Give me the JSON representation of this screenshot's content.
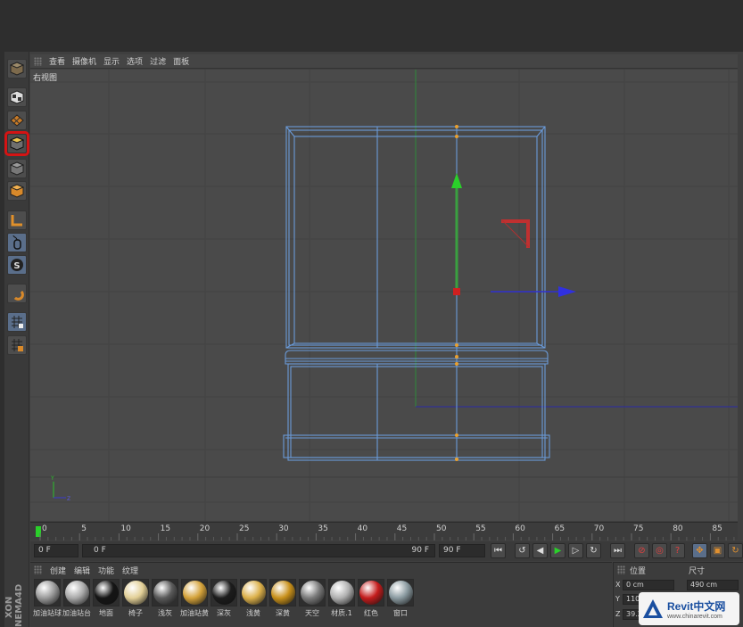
{
  "menu": {
    "items": [
      "查看",
      "摄像机",
      "显示",
      "选项",
      "过滤",
      "面板"
    ]
  },
  "viewport": {
    "label": "右视图"
  },
  "toolbar": {
    "tools": [
      "cube-view-icon",
      "checker-cube-icon",
      "texture-grid-icon",
      "polygon-object-icon",
      "cube-grey-icon",
      "cube-orange-icon",
      "axis-icon",
      "mouse-icon",
      "snap-s-icon",
      "magnet-icon",
      "grid-lock-icon",
      "grid-object-icon"
    ],
    "selected_tool": "polygon-object-icon"
  },
  "brand": "XON NEMA4D",
  "timeline": {
    "ticks": [
      "0",
      "5",
      "10",
      "15",
      "20",
      "25",
      "30",
      "35",
      "40",
      "45",
      "50",
      "55",
      "60",
      "65",
      "70",
      "75",
      "80",
      "85"
    ]
  },
  "playback": {
    "current_frame": "0 F",
    "range_start": "0 F",
    "range_end": "90 F",
    "max_frame": "90 F"
  },
  "materials": {
    "menu": [
      "创建",
      "编辑",
      "功能",
      "纹理"
    ],
    "items": [
      {
        "name": "加油站球",
        "color": "#9a9a9a"
      },
      {
        "name": "加油站台",
        "color": "#a8a8a8"
      },
      {
        "name": "地面",
        "color": "#151515"
      },
      {
        "name": "椅子",
        "color": "#e2cf96"
      },
      {
        "name": "浅灰",
        "color": "#5a5a5a"
      },
      {
        "name": "加油站黄",
        "color": "#d4a23a"
      },
      {
        "name": "深灰",
        "color": "#1c1c1c"
      },
      {
        "name": "浅黄",
        "color": "#dcb04a"
      },
      {
        "name": "深黄",
        "color": "#c8901a"
      },
      {
        "name": "天空",
        "color": "#7a7a7a"
      },
      {
        "name": "材质.1",
        "color": "#b0b0b0"
      },
      {
        "name": "红色",
        "color": "#c41c1c"
      },
      {
        "name": "窗口",
        "color": "#8a9aa0"
      }
    ]
  },
  "attributes": {
    "position_header": "位置",
    "size_header": "尺寸",
    "x_label": "X",
    "y_label": "Y",
    "z_label": "Z",
    "x_pos": "0 cm",
    "y_pos": "110",
    "z_pos": "39.2",
    "x_size": "490 cm"
  },
  "watermark": {
    "title": "Revit中文网",
    "url": "www.chinarevit.com"
  }
}
